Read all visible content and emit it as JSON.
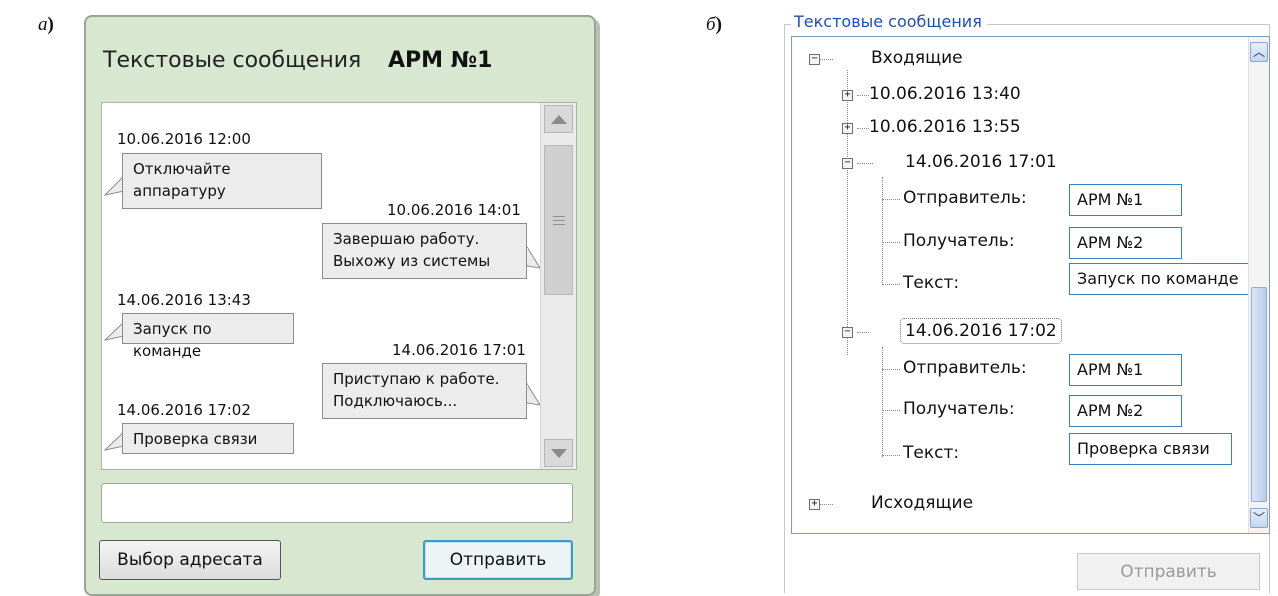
{
  "labels": {
    "a": "а",
    "b": "б",
    "paren": ")"
  },
  "panel_a": {
    "title": "Текстовые сообщения",
    "station": "АРМ №1",
    "messages": [
      {
        "time": "10.06.2016 12:00",
        "lines": [
          "Отключайте",
          "аппаратуру"
        ],
        "side": "left"
      },
      {
        "time": "10.06.2016 14:01",
        "lines": [
          "Завершаю работу.",
          "Выхожу из системы"
        ],
        "side": "right"
      },
      {
        "time": "14.06.2016 13:43",
        "lines": [
          "Запуск по команде"
        ],
        "side": "left"
      },
      {
        "time": "14.06.2016 17:01",
        "lines": [
          "Приступаю к работе.",
          "Подключаюсь..."
        ],
        "side": "right"
      },
      {
        "time": "14.06.2016 17:02",
        "lines": [
          "Проверка связи"
        ],
        "side": "left"
      }
    ],
    "input_value": "",
    "recipient_button": "Выбор адресата",
    "send_button": "Отправить"
  },
  "panel_b": {
    "group_title": "Текстовые сообщения",
    "tree": {
      "incoming_label": "Входящие",
      "incoming_items": [
        {
          "time": "10.06.2016 13:40",
          "expanded": false
        },
        {
          "time": "10.06.2016 13:55",
          "expanded": false
        },
        {
          "time": "14.06.2016 17:01",
          "expanded": true,
          "sender_label": "Отправитель:",
          "sender": "АРМ №1",
          "receiver_label": "Получатель:",
          "receiver": "АРМ №2",
          "text_label": "Текст:",
          "text": "Запуск по команде"
        },
        {
          "time": "14.06.2016 17:02",
          "expanded": true,
          "selected": true,
          "sender_label": "Отправитель:",
          "sender": "АРМ №1",
          "receiver_label": "Получатель:",
          "receiver": "АРМ №2",
          "text_label": "Текст:",
          "text": "Проверка связи"
        }
      ],
      "outgoing_label": "Исходящие"
    },
    "expand_glyph": "+",
    "collapse_glyph": "−",
    "send_button": "Отправить",
    "send_button_enabled": false
  },
  "colors": {
    "panel_a_bg": "#d8e7cf",
    "accent_blue": "#3b9ac0",
    "group_title": "#1c4fb4"
  }
}
